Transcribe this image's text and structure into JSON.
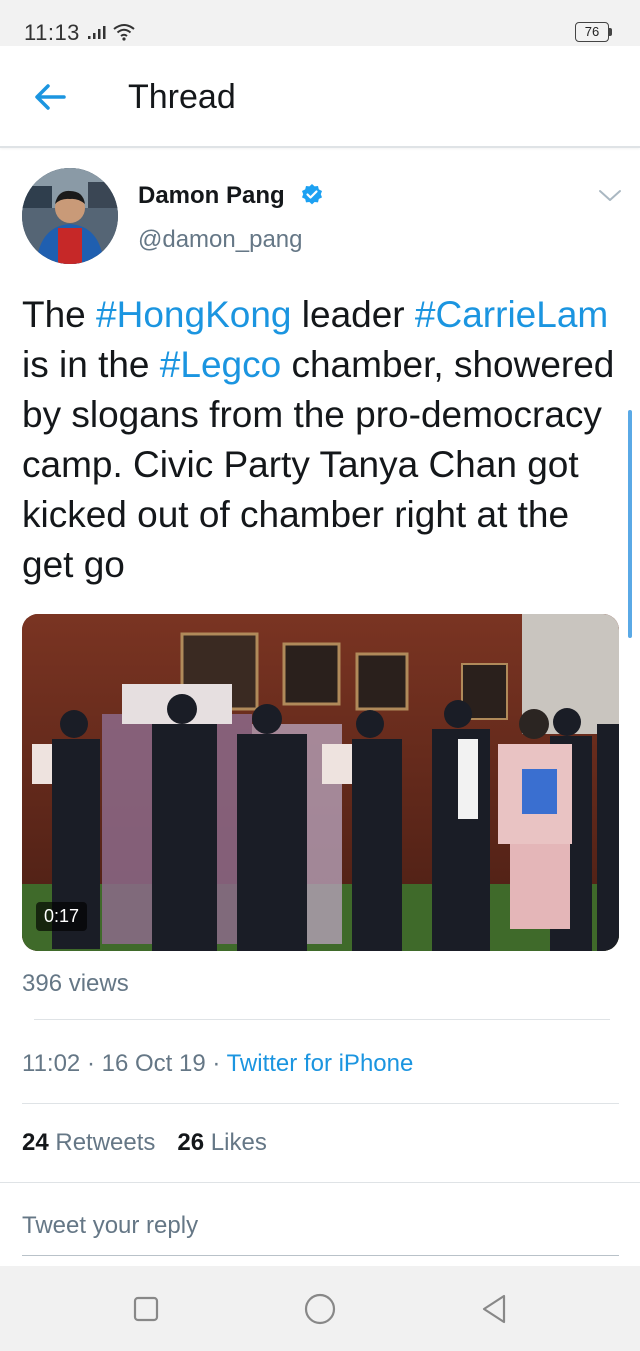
{
  "status_bar": {
    "time": "11:13",
    "battery": "76",
    "icons": [
      "signal-icon",
      "wifi-icon",
      "battery-icon"
    ]
  },
  "header": {
    "title": "Thread",
    "back_icon": "arrow-left-icon"
  },
  "tweet": {
    "author_name": "Damon Pang",
    "handle": "@damon_pang",
    "text_parts": {
      "p1": "The ",
      "tag1": "#HongKong",
      "p2": " leader ",
      "tag2": "#CarrieLam",
      "p3": " is in the ",
      "tag3": "#Legco",
      "p4": " chamber, showered by slogans from the pro-democracy camp. Civic Party Tanya Chan got kicked out of chamber right at the get go"
    },
    "video": {
      "duration": "0:17"
    },
    "views": "396 views",
    "meta": {
      "time": "11:02",
      "separator": " · ",
      "date": "16 Oct 19",
      "source": "Twitter for iPhone"
    },
    "stats": {
      "retweets_count": "24",
      "retweets_label": " Retweets",
      "likes_count": "26",
      "likes_label": " Likes"
    }
  },
  "reply": {
    "placeholder": "Tweet your reply"
  },
  "nav": {
    "icons": [
      "square-recents-icon",
      "circle-home-icon",
      "triangle-back-icon"
    ]
  },
  "colors": {
    "accent": "#1b95e0",
    "text": "#14171a",
    "secondary": "#657786",
    "divider": "#dfe3e6"
  }
}
